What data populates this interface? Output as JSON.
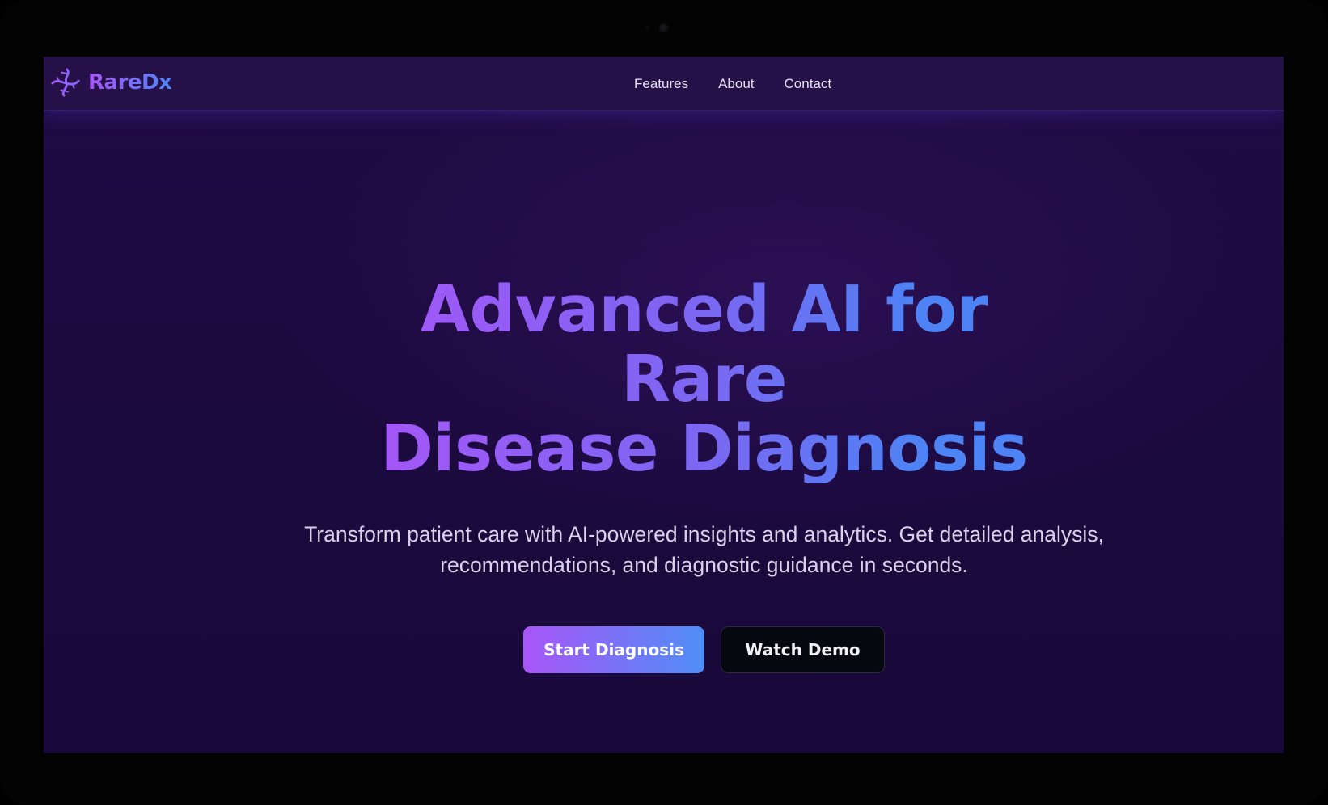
{
  "brand": {
    "name": "RareDx",
    "logo_icon": "dna-icon"
  },
  "nav": {
    "links": [
      "Features",
      "About",
      "Contact"
    ]
  },
  "hero": {
    "title_line1": "Advanced AI for Rare",
    "title_line2": "Disease Diagnosis",
    "subtitle_line1": "Transform patient care with AI-powered insights and analytics. Get detailed analysis,",
    "subtitle_line2": "recommendations, and diagnostic guidance in seconds.",
    "primary_button": "Start Diagnosis",
    "secondary_button": "Watch Demo"
  },
  "colors": {
    "accent_purple": "#a855f7",
    "accent_blue": "#4f86f7",
    "background": "#1c0a3f",
    "navbar": "#251047"
  }
}
